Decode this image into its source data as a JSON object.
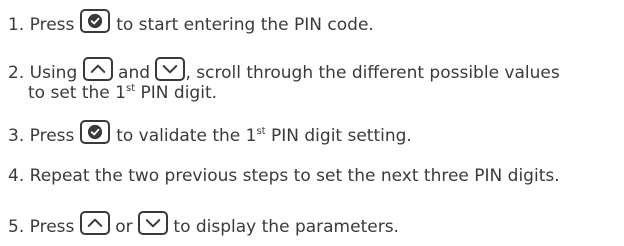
{
  "steps": [
    {
      "number": "1.",
      "before": "Press",
      "after": "to start entering the PIN code.",
      "icons": [
        "confirm-check-icon"
      ]
    },
    {
      "number": "2.",
      "before": "Using",
      "between": "and",
      "after": ", scroll through the different possible values",
      "line2_before": "to set the 1",
      "line2_sup": "st",
      "line2_after": " PIN digit.",
      "icons": [
        "chevron-up-icon",
        "chevron-down-icon"
      ]
    },
    {
      "number": "3.",
      "before": "Press",
      "after": "to validate the 1",
      "sup": "st",
      "after2": " PIN digit setting.",
      "icons": [
        "confirm-check-icon"
      ]
    },
    {
      "number": "4.",
      "text": "Repeat the two previous steps to set the next three PIN digits."
    },
    {
      "number": "5.",
      "before": "Press",
      "between": "or",
      "after": "to display the parameters.",
      "icons": [
        "chevron-up-icon",
        "chevron-down-icon"
      ]
    }
  ],
  "colors": {
    "text": "#3a3a3a",
    "button_border": "#3a3a3a",
    "background": "#ffffff"
  }
}
